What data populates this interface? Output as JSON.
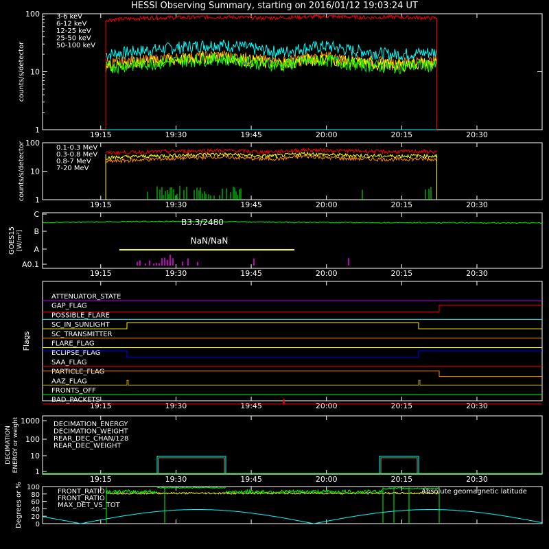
{
  "title": "HESSI Observing Summary, starting on 2016/01/12 19:03:24 UT",
  "time_ticks": [
    "19:15",
    "19:30",
    "19:45",
    "20:00",
    "20:15",
    "20:30"
  ],
  "colors": {
    "red": "#ff0000",
    "orange": "#ff8c00",
    "yellow": "#ffff00",
    "green": "#00ff00",
    "cyan": "#00ffff",
    "magenta": "#ff00ff",
    "blue": "#0000ff",
    "olive": "#b8a000",
    "purple": "#b000ff",
    "white": "#ffffff",
    "brown": "#b0a060"
  },
  "chart_data": [
    {
      "type": "line",
      "id": "lowE",
      "ylabel": "counts/s/detector",
      "ylim": [
        1,
        100
      ],
      "log": true,
      "yticks": [
        "1",
        "10",
        "100"
      ],
      "x_range": [
        "19:03:24",
        "20:43"
      ],
      "data_start": "19:16",
      "data_end": "20:22",
      "series": [
        {
          "name": "3-6 keV",
          "color": "#ff0000",
          "values": [
            78,
            82,
            85,
            86,
            87,
            88,
            87,
            84,
            86,
            88,
            90,
            88,
            86,
            88,
            86,
            84
          ]
        },
        {
          "name": "6-12 keV",
          "color": "#ff8c00",
          "values": [
            14,
            15,
            16,
            17,
            18,
            19,
            18,
            16,
            15,
            17,
            18,
            16,
            15,
            14,
            15,
            15
          ]
        },
        {
          "name": "12-25 keV",
          "color": "#ffff00",
          "values": [
            13,
            14,
            15,
            16,
            17,
            18,
            17,
            15,
            14,
            16,
            17,
            15,
            14,
            13,
            14,
            14
          ]
        },
        {
          "name": "25-50 keV",
          "color": "#00ff00",
          "values": [
            12,
            13,
            14,
            15,
            16,
            17,
            16,
            14,
            13,
            15,
            16,
            14,
            13,
            12,
            13,
            13
          ]
        },
        {
          "name": "50-100 keV",
          "color": "#00ffff",
          "values": [
            20,
            22,
            24,
            26,
            28,
            30,
            28,
            24,
            22,
            26,
            28,
            24,
            22,
            20,
            21,
            22
          ]
        }
      ]
    },
    {
      "type": "line",
      "id": "highE",
      "ylabel": "counts/s/detector",
      "ylim": [
        1,
        100
      ],
      "log": true,
      "yticks": [
        "1",
        "10",
        "100"
      ],
      "series": [
        {
          "name": "0.1-0.3 MeV",
          "color": "#ff0000",
          "values": [
            44,
            46,
            48,
            50,
            52,
            54,
            52,
            48,
            50,
            56,
            54,
            52,
            50,
            48,
            50,
            48
          ]
        },
        {
          "name": "0.3-0.8 MeV",
          "color": "#ff8c00",
          "values": [
            22,
            24,
            26,
            28,
            30,
            32,
            30,
            27,
            28,
            34,
            30,
            28,
            27,
            26,
            27,
            26
          ]
        },
        {
          "name": "0.8-7 MeV",
          "color": "#ffff00",
          "values": [
            30,
            32,
            34,
            36,
            38,
            40,
            38,
            34,
            36,
            42,
            38,
            36,
            35,
            34,
            35,
            34
          ]
        },
        {
          "name": "7-20 MeV",
          "color": "#00ff00",
          "values": []
        }
      ]
    },
    {
      "type": "line",
      "id": "goes",
      "ylabel": "GOES15 [W/m^2]",
      "ytick_labels": [
        "A0.1",
        "A",
        "B",
        "C"
      ],
      "annotation_top": "B3.3/2480",
      "annotation_bottom": "NaN/NaN",
      "series": [
        {
          "name": "GOES long",
          "color": "#00ff00",
          "values": [
            0.55,
            0.62,
            0.7,
            0.75,
            0.72,
            0.65,
            0.6,
            0.58,
            0.56,
            0.55,
            0.54,
            0.53,
            0.52
          ]
        }
      ]
    },
    {
      "type": "table",
      "id": "flags",
      "ylabel": "Flags",
      "flags": [
        {
          "name": "ATTENUATOR_STATE",
          "color": "#b000ff"
        },
        {
          "name": "GAP_FLAG",
          "color": "#ff0000"
        },
        {
          "name": "POSSIBLE_FLARE",
          "color": "#00ffff"
        },
        {
          "name": "SC_IN_SUNLIGHT",
          "color": "#ffff00"
        },
        {
          "name": "SC_TRANSMITTER",
          "color": "#ff8c00"
        },
        {
          "name": "FLARE_FLAG",
          "color": "#ffff00"
        },
        {
          "name": "ECLIPSE_FLAG",
          "color": "#0000ff"
        },
        {
          "name": "SAA_FLAG",
          "color": "#ff0000"
        },
        {
          "name": "PARTICLE_FLAG",
          "color": "#ff8c00"
        },
        {
          "name": "AAZ_FLAG",
          "color": "#b8a000"
        },
        {
          "name": "FRONTS_OFF",
          "color": "#00ff00"
        },
        {
          "name": "BAD_PACKETS",
          "color": "#ff0000"
        }
      ]
    },
    {
      "type": "line",
      "id": "decim",
      "ylabel": "DECIMATION ENERGY or weight",
      "yticks": [
        "1",
        "10",
        "100",
        "1000"
      ],
      "series": [
        {
          "name": "DECIMATION_ENERGY",
          "color": "#00ff00"
        },
        {
          "name": "DECIMATION_WEIGHT",
          "color": "#ff8c00"
        },
        {
          "name": "REAR_DEC_CHAN/128",
          "color": "#00ffff"
        },
        {
          "name": "REAR_DEC_WEIGHT",
          "color": "#b0a060"
        }
      ]
    },
    {
      "type": "line",
      "id": "ratio",
      "ylabel": "Degrees or %",
      "yticks": [
        "0",
        "20",
        "40",
        "60",
        "80",
        "100"
      ],
      "series": [
        {
          "name": "FRONT_RATIO",
          "color": "#00ff00"
        },
        {
          "name": "FRONT_RATIO",
          "color": "#ffff00"
        },
        {
          "name": "MAX_DET_VS_TOT",
          "color": "#ff8c00"
        },
        {
          "name": "Absolute geomagnetic latitude",
          "color": "#00ffff"
        }
      ]
    }
  ]
}
